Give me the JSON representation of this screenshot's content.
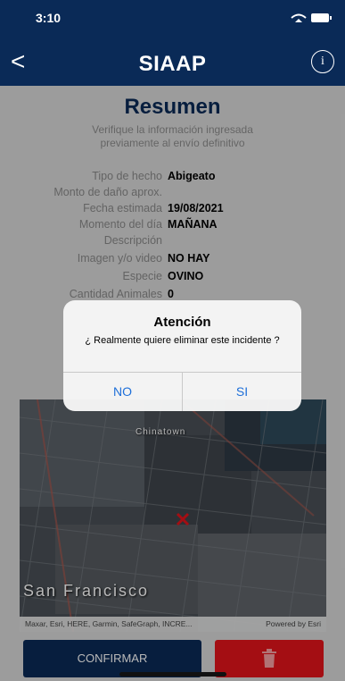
{
  "status_bar": {
    "time": "3:10",
    "icons": [
      "wifi-icon",
      "battery-icon"
    ]
  },
  "navbar": {
    "back": "<",
    "title": "SIAAP",
    "info": "i"
  },
  "summary": {
    "title": "Resumen",
    "subtitle": "Verifique la información ingresada previamente al envío definitivo"
  },
  "details": [
    {
      "label": "Tipo de hecho",
      "value": "Abigeato"
    },
    {
      "label": "Monto de daño aprox.",
      "value": ""
    },
    {
      "label": "Fecha estimada",
      "value": "19/08/2021"
    },
    {
      "label": "Momento del día",
      "value": "MAÑANA"
    },
    {
      "label": "Descripción",
      "value": ""
    },
    {
      "label": "Imagen y/o video",
      "value": "NO HAY"
    },
    {
      "label": "Especie",
      "value": "OVINO"
    },
    {
      "label": "Cantidad Animales",
      "value": "0"
    }
  ],
  "map": {
    "city_label": "San Francisco",
    "area_label": "Chinatown",
    "attribution_left": "Maxar, Esri, HERE, Garmin, SafeGraph, INCRE...",
    "attribution_right": "Powered by Esri"
  },
  "actions": {
    "confirm": "CONFIRMAR",
    "delete_icon": "trash-icon"
  },
  "dialog": {
    "title": "Atención",
    "message": "¿ Realmente quiere eliminar este incidente ?",
    "no": "NO",
    "yes": "SI"
  },
  "colors": {
    "primary": "#0a2a57",
    "danger": "#e3141b",
    "dialog_button": "#1e6fd9"
  }
}
